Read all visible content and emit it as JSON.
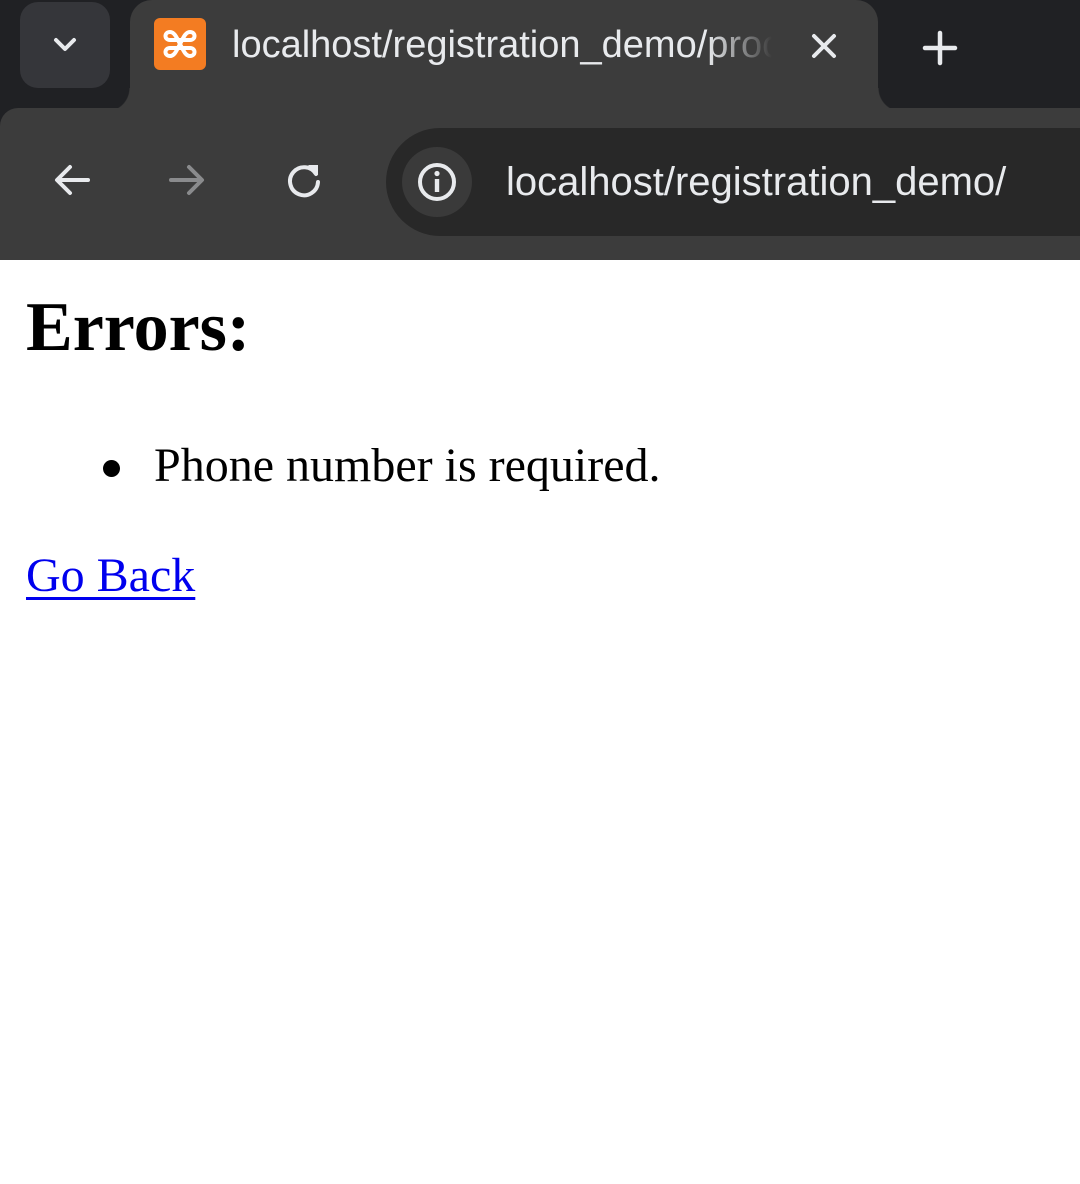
{
  "browser": {
    "tab": {
      "title": "localhost/registration_demo/process.php",
      "favicon": "xampp-icon",
      "close_icon": "close-icon"
    },
    "new_tab_icon": "plus-icon",
    "tab_search_icon": "chevron-down-icon",
    "toolbar": {
      "back_icon": "arrow-left-icon",
      "forward_icon": "arrow-right-icon",
      "reload_icon": "reload-icon",
      "site_info_icon": "info-icon",
      "url": "localhost/registration_demo/"
    }
  },
  "page": {
    "heading": "Errors:",
    "errors": [
      "Phone number is required."
    ],
    "back_link": "Go Back"
  },
  "colors": {
    "tab_strip_bg": "#202124",
    "toolbar_bg": "#3c3c3c",
    "favicon_bg": "#f37c22",
    "link": "#0000ee",
    "page_bg": "#ffffff"
  }
}
